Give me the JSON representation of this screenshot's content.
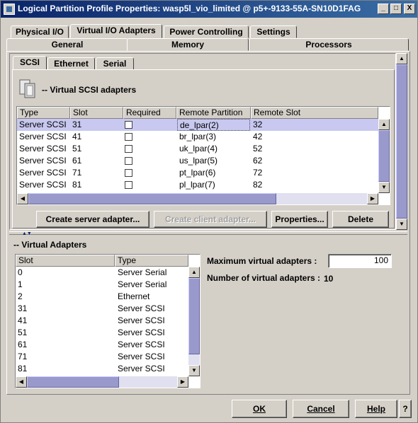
{
  "window": {
    "title": "Logical Partition Profile Properties: wasp5l_vio_limited @ p5+-9133-55A-SN10D1FAG",
    "minimize": "_",
    "maximize": "□",
    "close": "X"
  },
  "tabs_row1": [
    "Physical I/O",
    "Virtual I/O Adapters",
    "Power Controlling",
    "Settings"
  ],
  "tabs_row2": [
    "General",
    "Memory",
    "Processors"
  ],
  "subtabs": [
    "SCSI",
    "Ethernet",
    "Serial"
  ],
  "scsi_section": {
    "heading": "-- Virtual SCSI adapters",
    "columns": [
      "Type",
      "Slot",
      "Required",
      "Remote Partition",
      "Remote Slot"
    ],
    "rows": [
      {
        "type": "Server SCSI",
        "slot": "31",
        "remote_partition": "de_lpar(2)",
        "remote_slot": "32"
      },
      {
        "type": "Server SCSI",
        "slot": "41",
        "remote_partition": "br_lpar(3)",
        "remote_slot": "42"
      },
      {
        "type": "Server SCSI",
        "slot": "51",
        "remote_partition": "uk_lpar(4)",
        "remote_slot": "52"
      },
      {
        "type": "Server SCSI",
        "slot": "61",
        "remote_partition": "us_lpar(5)",
        "remote_slot": "62"
      },
      {
        "type": "Server SCSI",
        "slot": "71",
        "remote_partition": "pt_lpar(6)",
        "remote_slot": "72"
      },
      {
        "type": "Server SCSI",
        "slot": "81",
        "remote_partition": "pl_lpar(7)",
        "remote_slot": "82"
      }
    ],
    "buttons": {
      "create_server": "Create server adapter...",
      "create_client": "Create client adapter...",
      "properties": "Properties...",
      "delete": "Delete"
    }
  },
  "virtual_adapters": {
    "heading": "-- Virtual Adapters",
    "columns": [
      "Slot",
      "Type"
    ],
    "rows": [
      {
        "slot": "0",
        "type": "Server Serial"
      },
      {
        "slot": "1",
        "type": "Server Serial"
      },
      {
        "slot": "2",
        "type": "Ethernet"
      },
      {
        "slot": "31",
        "type": "Server SCSI"
      },
      {
        "slot": "41",
        "type": "Server SCSI"
      },
      {
        "slot": "51",
        "type": "Server SCSI"
      },
      {
        "slot": "61",
        "type": "Server SCSI"
      },
      {
        "slot": "71",
        "type": "Server SCSI"
      },
      {
        "slot": "81",
        "type": "Server SCSI"
      }
    ],
    "max_label": "Maximum virtual adapters :",
    "max_value": "100",
    "count_label": "Number of virtual adapters :",
    "count_value": "10"
  },
  "footer": {
    "ok": "OK",
    "cancel": "Cancel",
    "help": "Help",
    "question": "?"
  },
  "colors": {
    "title_bar": "#0a246a",
    "selection": "#c8c8f0",
    "scroll_thumb": "#9999cc"
  }
}
